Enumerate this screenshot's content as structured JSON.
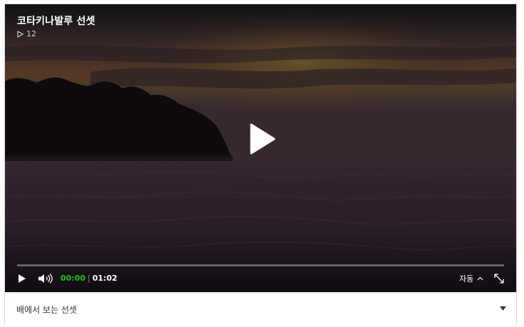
{
  "video": {
    "title": "코타키나발루 선셋",
    "views": "12",
    "current_time": "00:00",
    "time_separator": "|",
    "duration": "01:02",
    "progress_fraction": 0,
    "auto_label": "자동",
    "accent_color": "#1ec800"
  },
  "caption": {
    "text": "배에서 보는 선셋"
  },
  "icons": {
    "views": "play-outline-icon",
    "center": "play-icon",
    "control_play": "play-icon",
    "volume": "volume-icon",
    "auto_toggle": "chevron-up-icon",
    "fullscreen": "fullscreen-icon",
    "caption_toggle": "caret-down-icon"
  }
}
